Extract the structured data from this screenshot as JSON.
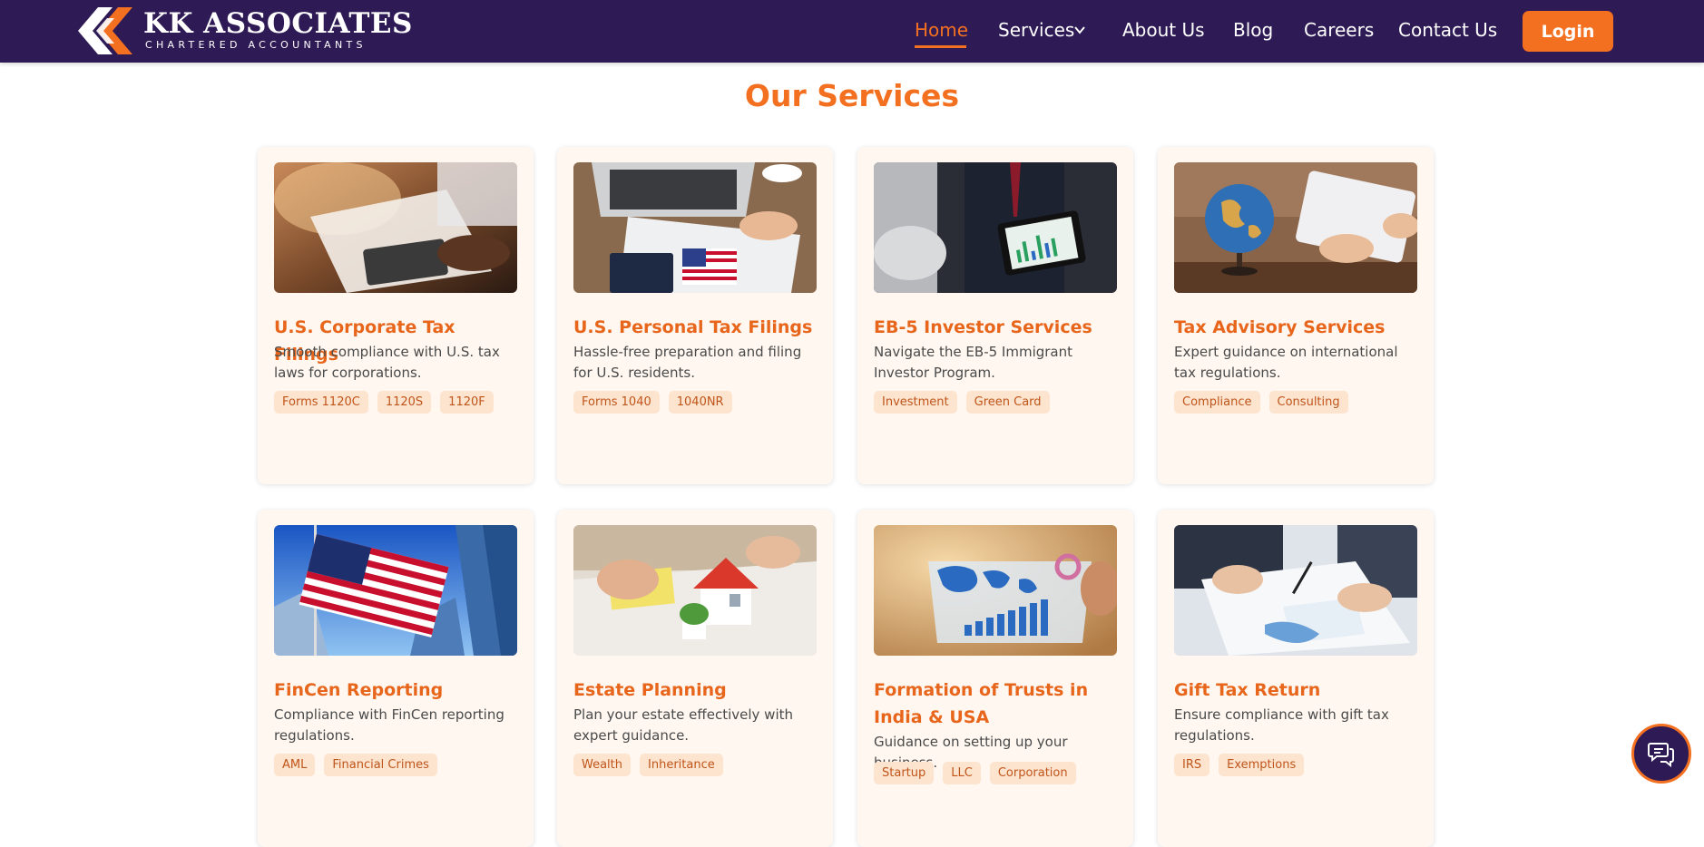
{
  "brand": {
    "name": "KK ASSOCIATES",
    "tagline": "CHARTERED ACCOUNTANTS"
  },
  "nav": {
    "items": [
      {
        "label": "Home",
        "active": true
      },
      {
        "label": "Services",
        "has_dropdown": true
      },
      {
        "label": "About Us"
      },
      {
        "label": "Blog"
      },
      {
        "label": "Careers"
      },
      {
        "label": "Contact Us"
      }
    ],
    "login_label": "Login"
  },
  "section": {
    "title": "Our Services"
  },
  "services": [
    {
      "title": "U.S. Corporate Tax Filings",
      "description": "Smooth compliance with U.S. tax laws for corporations.",
      "tags": [
        "Forms 1120C",
        "1120S",
        "1120F"
      ],
      "image": "calculator-documents-photo"
    },
    {
      "title": "U.S. Personal Tax Filings",
      "description": "Hassle-free preparation and filing for U.S. residents.",
      "tags": [
        "Forms 1040",
        "1040NR"
      ],
      "image": "laptop-passport-flag-photo"
    },
    {
      "title": "EB-5 Investor Services",
      "description": "Navigate the EB-5 Immigrant Investor Program.",
      "tags": [
        "Investment",
        "Green Card"
      ],
      "image": "businessmen-tablet-chart-photo"
    },
    {
      "title": "Tax Advisory Services",
      "description": "Expert guidance on international tax regulations.",
      "tags": [
        "Compliance",
        "Consulting"
      ],
      "image": "globe-tablet-photo"
    },
    {
      "title": "FinCen Reporting",
      "description": "Compliance with FinCen reporting regulations.",
      "tags": [
        "AML",
        "Financial Crimes"
      ],
      "image": "american-flag-skyscrapers-photo"
    },
    {
      "title": "Estate Planning",
      "description": "Plan your estate effectively with expert guidance.",
      "tags": [
        "Wealth",
        "Inheritance"
      ],
      "image": "house-model-paperwork-photo"
    },
    {
      "title": "Formation of Trusts in India & USA",
      "description": "Guidance on setting up your business.",
      "tags": [
        "Startup",
        "LLC",
        "Corporation"
      ],
      "image": "world-map-analytics-photo"
    },
    {
      "title": "Gift Tax Return",
      "description": "Ensure compliance with gift tax regulations.",
      "tags": [
        "IRS",
        "Exemptions"
      ],
      "image": "document-review-photo"
    }
  ],
  "colors": {
    "nav_bg": "#2e1a55",
    "accent": "#f37021",
    "card_bg": "#fff7f0",
    "tag_bg": "#fde4cf"
  },
  "icons": {
    "dropdown": "chevron-down-icon",
    "chat": "chat-bubbles-icon"
  }
}
